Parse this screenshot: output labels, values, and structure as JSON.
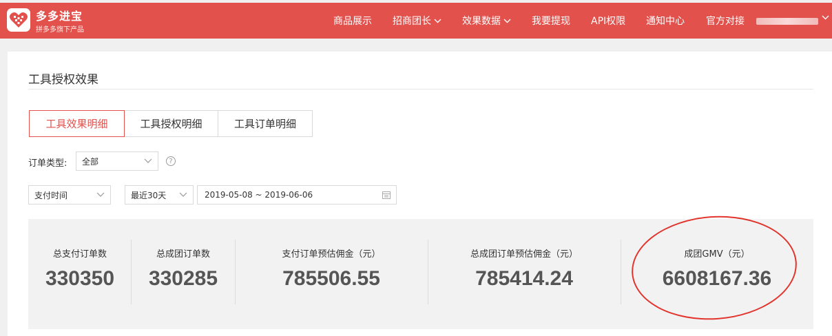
{
  "header": {
    "brand_title": "多多进宝",
    "brand_subtitle": "拼多多旗下产品",
    "nav": [
      {
        "label": "商品展示",
        "dropdown": false
      },
      {
        "label": "招商团长",
        "dropdown": true
      },
      {
        "label": "效果数据",
        "dropdown": true
      },
      {
        "label": "我要提现",
        "dropdown": false
      },
      {
        "label": "API权限",
        "dropdown": false
      },
      {
        "label": "通知中心",
        "dropdown": false
      },
      {
        "label": "官方对接",
        "dropdown": false
      }
    ],
    "brand_color": "#e2514c"
  },
  "page": {
    "title": "工具授权效果"
  },
  "tabs": [
    {
      "label": "工具效果明细",
      "active": true
    },
    {
      "label": "工具授权明细",
      "active": false
    },
    {
      "label": "工具订单明细",
      "active": false
    }
  ],
  "filters": {
    "order_type_label": "订单类型:",
    "order_type_value": "全部",
    "time_type_value": "支付时间",
    "range_preset_value": "最近30天",
    "date_range_value": "2019-05-08 ~ 2019-06-06"
  },
  "stats": [
    {
      "label": "总支付订单数",
      "value": "330350"
    },
    {
      "label": "总成团订单数",
      "value": "330285"
    },
    {
      "label": "支付订单预估佣金（元）",
      "value": "785506.55"
    },
    {
      "label": "总成团订单预估佣金（元）",
      "value": "785414.24"
    },
    {
      "label": "成团GMV（元）",
      "value": "6608167.36"
    }
  ],
  "annotation_color": "#e2342c"
}
